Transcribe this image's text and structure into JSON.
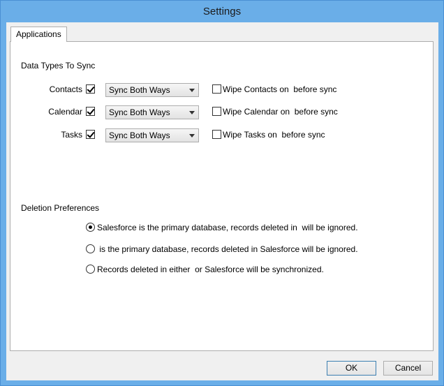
{
  "window": {
    "title": "Settings"
  },
  "tabs": [
    {
      "label": "Applications"
    }
  ],
  "sync": {
    "heading": "Data Types To Sync",
    "rows": [
      {
        "label": "Contacts",
        "checked": true,
        "mode": "Sync Both Ways",
        "wipe_label": "Wipe Contacts on  before sync",
        "wipe_checked": false
      },
      {
        "label": "Calendar",
        "checked": true,
        "mode": "Sync Both Ways",
        "wipe_label": "Wipe Calendar on  before sync",
        "wipe_checked": false
      },
      {
        "label": "Tasks",
        "checked": true,
        "mode": "Sync Both Ways",
        "wipe_label": "Wipe Tasks on  before sync",
        "wipe_checked": false
      }
    ]
  },
  "deletion": {
    "heading": "Deletion Preferences",
    "options": [
      {
        "label": "Salesforce is the primary database, records deleted in  will be ignored.",
        "selected": true
      },
      {
        "label": " is the primary database, records deleted in Salesforce will be ignored.",
        "selected": false
      },
      {
        "label": "Records deleted in either  or Salesforce will be synchronized.",
        "selected": false
      }
    ]
  },
  "buttons": {
    "ok": "OK",
    "cancel": "Cancel"
  }
}
